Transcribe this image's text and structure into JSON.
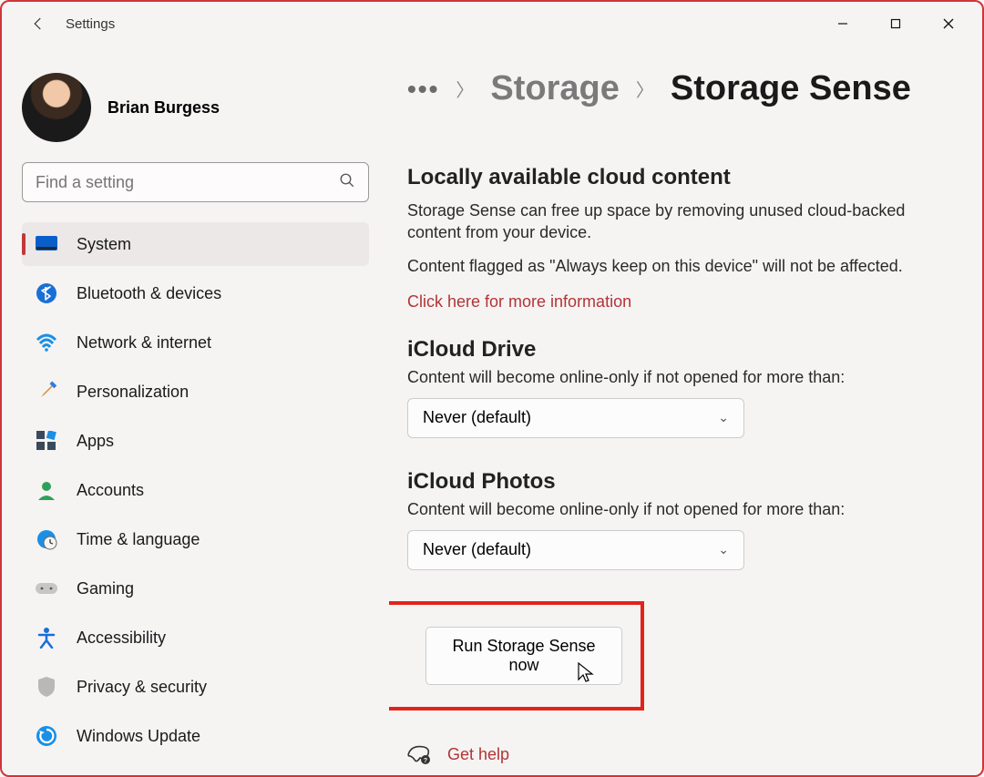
{
  "app": {
    "title": "Settings"
  },
  "user": {
    "name": "Brian Burgess"
  },
  "search": {
    "placeholder": "Find a setting"
  },
  "nav": {
    "items": [
      {
        "label": "System"
      },
      {
        "label": "Bluetooth & devices"
      },
      {
        "label": "Network & internet"
      },
      {
        "label": "Personalization"
      },
      {
        "label": "Apps"
      },
      {
        "label": "Accounts"
      },
      {
        "label": "Time & language"
      },
      {
        "label": "Gaming"
      },
      {
        "label": "Accessibility"
      },
      {
        "label": "Privacy & security"
      },
      {
        "label": "Windows Update"
      }
    ]
  },
  "breadcrumb": {
    "parent": "Storage",
    "current": "Storage Sense"
  },
  "main": {
    "cloud": {
      "title": "Locally available cloud content",
      "desc": "Storage Sense can free up space by removing unused cloud-backed content from your device.",
      "note": "Content flagged as \"Always keep on this device\" will not be affected.",
      "link": "Click here for more information"
    },
    "icloud_drive": {
      "title": "iCloud Drive",
      "desc": "Content will become online-only if not opened for more than:",
      "value": "Never (default)"
    },
    "icloud_photos": {
      "title": "iCloud Photos",
      "desc": "Content will become online-only if not opened for more than:",
      "value": "Never (default)"
    },
    "run_button": "Run Storage Sense now",
    "help": "Get help"
  }
}
